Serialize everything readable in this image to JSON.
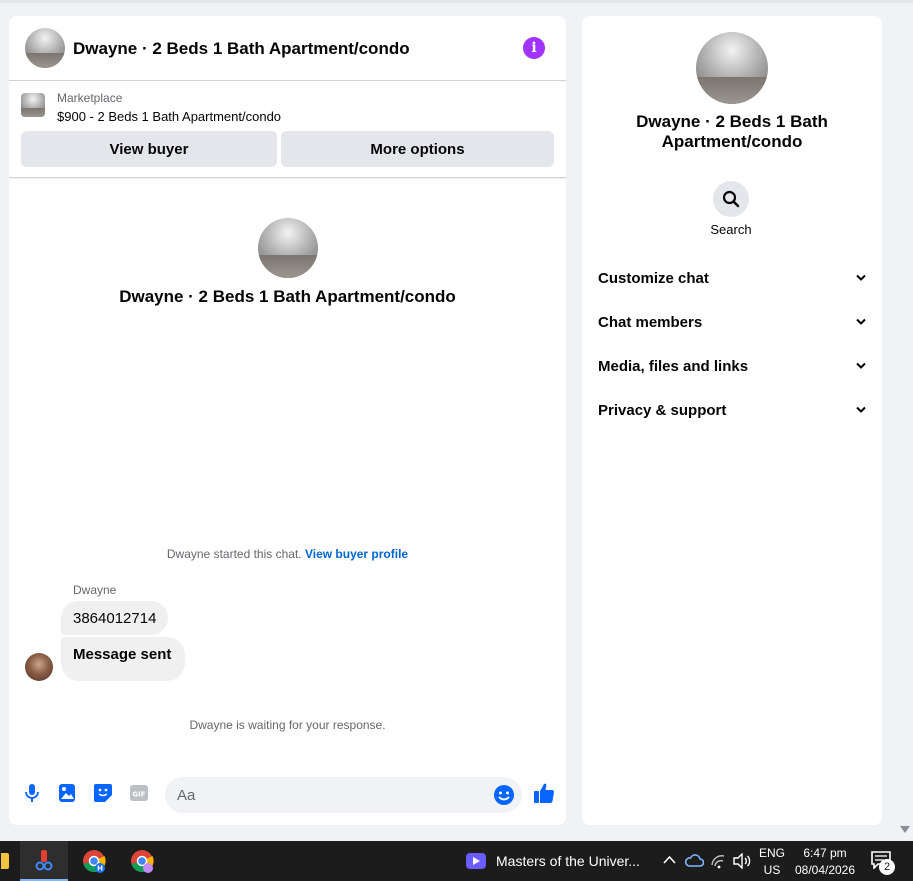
{
  "chat": {
    "title": "Dwayne · 2 Beds 1 Bath Apartment/condo",
    "listing": {
      "source": "Marketplace",
      "price_line": "$900 - 2 Beds 1 Bath Apartment/condo"
    },
    "buttons": {
      "view_buyer": "View buyer",
      "more_options": "More options"
    },
    "intro_title": "Dwayne · 2 Beds 1 Bath Apartment/condo",
    "started_text": "Dwayne started this chat.",
    "view_buyer_profile": "View buyer profile",
    "messages": {
      "sender": "Dwayne",
      "items": [
        "3864012714",
        "Message sent"
      ]
    },
    "waiting_text": "Dwayne is waiting for your response.",
    "composer": {
      "placeholder": "Aa",
      "accent": "#0866ff"
    },
    "info_color": "#a033ff"
  },
  "info_panel": {
    "title": "Dwayne · 2 Beds 1 Bath Apartment/condo",
    "search_label": "Search",
    "sections": [
      "Customize chat",
      "Chat members",
      "Media, files and links",
      "Privacy & support"
    ]
  },
  "taskbar": {
    "media_title": "Masters of the Univer...",
    "lang_top": "ENG",
    "lang_bottom": "US",
    "time": "6:47 pm",
    "date": "08/04/2026",
    "notification_count": "2"
  }
}
